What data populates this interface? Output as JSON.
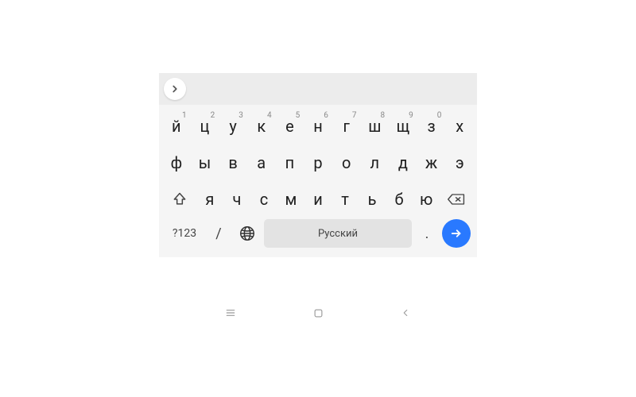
{
  "keyboard": {
    "row1": [
      {
        "char": "й",
        "hint": "1"
      },
      {
        "char": "ц",
        "hint": "2"
      },
      {
        "char": "у",
        "hint": "3"
      },
      {
        "char": "к",
        "hint": "4"
      },
      {
        "char": "е",
        "hint": "5"
      },
      {
        "char": "н",
        "hint": "6"
      },
      {
        "char": "г",
        "hint": "7"
      },
      {
        "char": "ш",
        "hint": "8"
      },
      {
        "char": "щ",
        "hint": "9"
      },
      {
        "char": "з",
        "hint": "0"
      },
      {
        "char": "х",
        "hint": ""
      }
    ],
    "row2": [
      {
        "char": "ф"
      },
      {
        "char": "ы"
      },
      {
        "char": "в"
      },
      {
        "char": "а"
      },
      {
        "char": "п"
      },
      {
        "char": "р"
      },
      {
        "char": "о"
      },
      {
        "char": "л"
      },
      {
        "char": "д"
      },
      {
        "char": "ж"
      },
      {
        "char": "э"
      }
    ],
    "row3": [
      {
        "char": "я"
      },
      {
        "char": "ч"
      },
      {
        "char": "с"
      },
      {
        "char": "м"
      },
      {
        "char": "и"
      },
      {
        "char": "т"
      },
      {
        "char": "ь"
      },
      {
        "char": "б"
      },
      {
        "char": "ю"
      }
    ],
    "symbols_label": "?123",
    "slash_label": "/",
    "space_label": "Русский",
    "period_label": "."
  }
}
